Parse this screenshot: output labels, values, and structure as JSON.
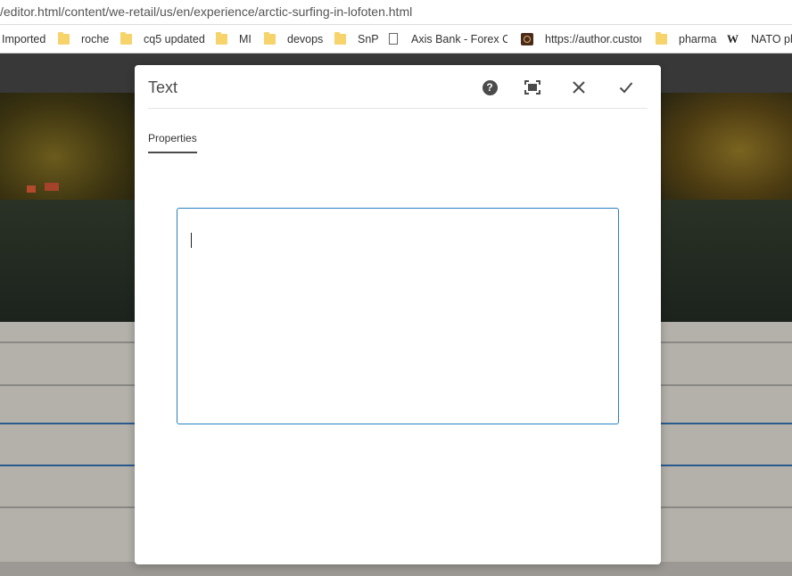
{
  "browser": {
    "url": "/editor.html/content/we-retail/us/en/experience/arctic-surfing-in-lofoten.html",
    "bookmarks": [
      {
        "label": "Imported",
        "icon": "none"
      },
      {
        "label": "roche",
        "icon": "folder-icon"
      },
      {
        "label": "cq5 updated",
        "icon": "folder-icon"
      },
      {
        "label": "MI",
        "icon": "folder-icon"
      },
      {
        "label": "devops",
        "icon": "folder-icon"
      },
      {
        "label": "SnP",
        "icon": "folder-icon"
      },
      {
        "label": "Axis Bank - Forex Ca",
        "icon": "page-icon"
      },
      {
        "label": "https://author.custor",
        "icon": "site-icon"
      },
      {
        "label": "pharma",
        "icon": "folder-icon"
      },
      {
        "label": "NATO ph",
        "icon": "wikipedia-icon"
      }
    ],
    "wiki_glyph": "W"
  },
  "dialog": {
    "title": "Text",
    "help_glyph": "?",
    "tabs": [
      {
        "label": "Properties",
        "active": true
      }
    ],
    "editor_value": ""
  },
  "colors": {
    "accent": "#2680c2",
    "title_text": "#4b4b4b"
  }
}
